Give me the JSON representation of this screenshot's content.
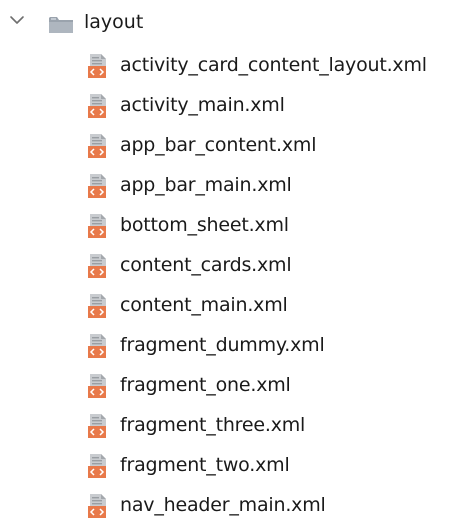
{
  "tree": {
    "folder": {
      "label": "layout",
      "icon": "folder-icon",
      "expanded_icon": "chevron-down-icon",
      "expanded": true
    },
    "files": [
      {
        "label": "activity_card_content_layout.xml",
        "icon": "layout-xml-file-icon"
      },
      {
        "label": "activity_main.xml",
        "icon": "layout-xml-file-icon"
      },
      {
        "label": "app_bar_content.xml",
        "icon": "layout-xml-file-icon"
      },
      {
        "label": "app_bar_main.xml",
        "icon": "layout-xml-file-icon"
      },
      {
        "label": "bottom_sheet.xml",
        "icon": "layout-xml-file-icon"
      },
      {
        "label": "content_cards.xml",
        "icon": "layout-xml-file-icon"
      },
      {
        "label": "content_main.xml",
        "icon": "layout-xml-file-icon"
      },
      {
        "label": "fragment_dummy.xml",
        "icon": "layout-xml-file-icon"
      },
      {
        "label": "fragment_one.xml",
        "icon": "layout-xml-file-icon"
      },
      {
        "label": "fragment_three.xml",
        "icon": "layout-xml-file-icon"
      },
      {
        "label": "fragment_two.xml",
        "icon": "layout-xml-file-icon"
      },
      {
        "label": "nav_header_main.xml",
        "icon": "layout-xml-file-icon"
      }
    ]
  },
  "colors": {
    "folder": "#9aa3ad",
    "folder_light": "#c3cad2",
    "file_sheet": "#b9bcc0",
    "xml_badge": "#e8794a",
    "chevron": "#6e6e6e",
    "text": "#1a1a1a"
  }
}
